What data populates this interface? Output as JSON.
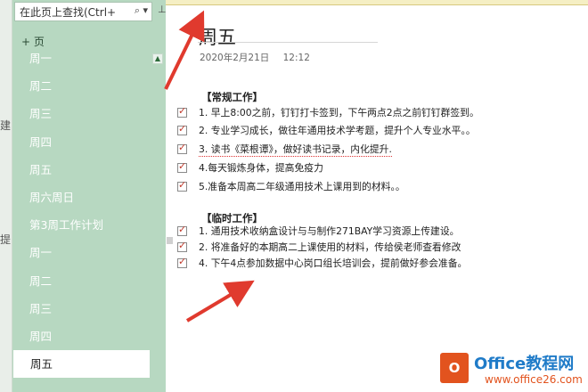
{
  "left_strip": {
    "fragment_1": "建",
    "fragment_2": "提"
  },
  "search": {
    "placeholder": "在此页上查找(Ctrl+",
    "icon": "search-icon"
  },
  "sidebar": {
    "add_page_label": "+ 页",
    "pages": [
      "周一",
      "周二",
      "周三",
      "周四",
      "周五",
      "周六周日",
      "第3周工作计划",
      "周一",
      "周二",
      "周三",
      "周四",
      "周五"
    ],
    "selected_index": 11
  },
  "note": {
    "title": "周五",
    "date": "2020年2月21日",
    "time": "12:12",
    "section1": {
      "heading": "【常规工作】",
      "tasks": [
        "1. 早上8:00之前，钉钉打卡签到，下午两点2点之前钉钉群签到。",
        "2. 专业学习成长，做往年通用技术学考题，提升个人专业水平。。",
        "3. 读书《菜根谭》，做好读书记录，内化提升.",
        "4.每天锻炼身体，提高免疫力",
        "5.准备本周高二年级通用技术上课用到的材料。。"
      ]
    },
    "section2": {
      "heading": "【临时工作】",
      "tasks": [
        "1. 通用技术收纳盒设计与与制作271BAY学习资源上传建设。",
        "2. 将准备好的本期高二上课使用的材料，传给侯老师查看修改",
        "4. 下午4点参加数据中心岗口组长培训会，提前做好参会准备。"
      ]
    }
  },
  "watermark": {
    "logo_text": "O",
    "title": "Office教程网",
    "url": "www.office26.com"
  },
  "colors": {
    "sidebar": "#b7d8c1",
    "arrow": "#e03a2e",
    "check": "#c0392b",
    "brand_blue": "#1f7bc8",
    "brand_orange": "#e2531e"
  }
}
